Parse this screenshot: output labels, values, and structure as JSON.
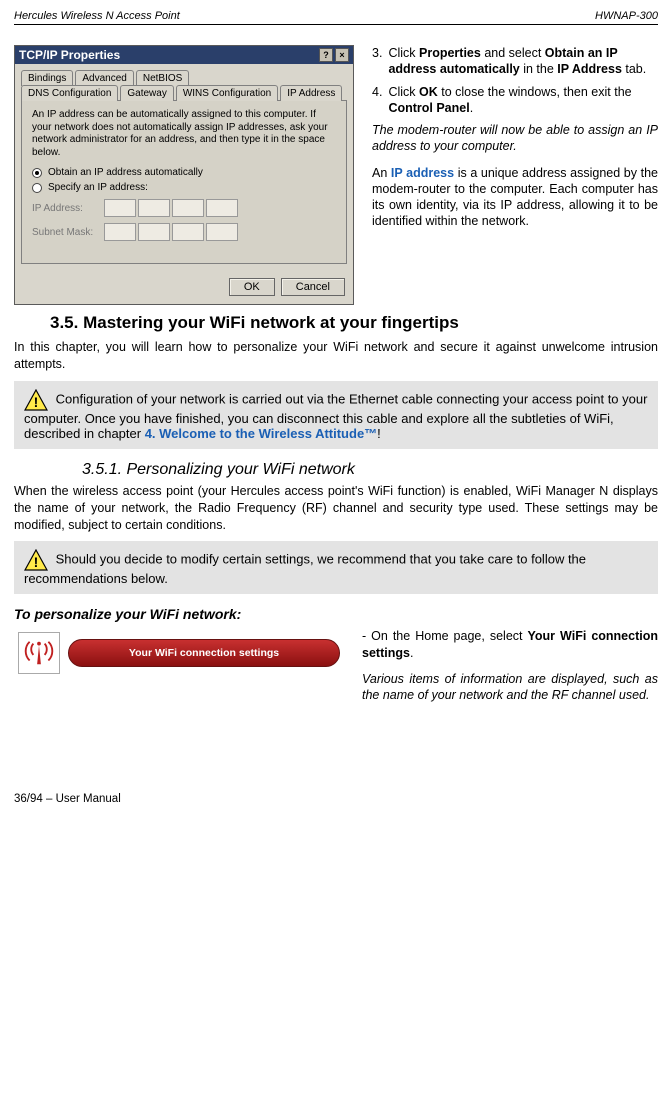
{
  "header": {
    "left": "Hercules Wireless N Access Point",
    "right": "HWNAP-300"
  },
  "dialog": {
    "title": "TCP/IP Properties",
    "tabs_row1": [
      "Bindings",
      "Advanced",
      "NetBIOS"
    ],
    "tabs_row2": [
      "DNS Configuration",
      "Gateway",
      "WINS Configuration",
      "IP Address"
    ],
    "desc": "An IP address can be automatically assigned to this computer. If your network does not automatically assign IP addresses, ask your network administrator for an address, and then type it in the space below.",
    "radio1": "Obtain an IP address automatically",
    "radio2": "Specify an IP address:",
    "field1": "IP Address:",
    "field2": "Subnet Mask:",
    "ok": "OK",
    "cancel": "Cancel"
  },
  "steps": {
    "s3": {
      "n": "3.",
      "text_a": "Click ",
      "prop": "Properties",
      "text_b": " and select ",
      "obt": "Obtain an IP address automatically",
      "text_c": " in the ",
      "iptab": "IP Address",
      "text_d": " tab."
    },
    "s4": {
      "n": "4.",
      "text_a": "Click ",
      "ok": "OK",
      "text_b": " to close the windows, then exit the ",
      "cp": "Control Panel",
      "text_c": "."
    }
  },
  "para_modem": "The modem-router will now be able to assign an IP address to your computer.",
  "para_ip_a": "An ",
  "para_ip_link": "IP address",
  "para_ip_b": " is a unique address assigned by the modem-router to the computer.  Each computer has its own identity, via its IP address, allowing it to be identified within the network.",
  "h35": "3.5.  Mastering your WiFi network at your fingertips",
  "p35": "In this chapter, you will learn how to personalize your WiFi network and secure it against unwelcome intrusion attempts.",
  "note1_a": " Configuration of your network is carried out via the Ethernet cable connecting your access point to your computer.  Once you have finished, you can disconnect this cable and explore all the subtleties of WiFi, described in chapter ",
  "note1_link": "4. Welcome to the Wireless Attitude™",
  "note1_b": "!",
  "h351": "3.5.1. Personalizing your WiFi network",
  "p351": "When the wireless access point (your Hercules access point's WiFi function) is enabled, WiFi Manager N displays the name of your network, the Radio Frequency (RF) channel and security type used.  These settings may be modified, subject to certain conditions.",
  "note2": " Should you decide to modify certain settings, we recommend that you take care to follow the recommendations below.",
  "h_personalize": "To personalize your WiFi network:",
  "wifi_btn": "Your WiFi connection settings",
  "right2_a": "- On the Home page, select ",
  "right2_link": "Your WiFi connection settings",
  "right2_b": ".",
  "right2_c": "Various items of information are displayed, such as the name of your network and the RF channel used.",
  "footer": "36/94 – User Manual"
}
